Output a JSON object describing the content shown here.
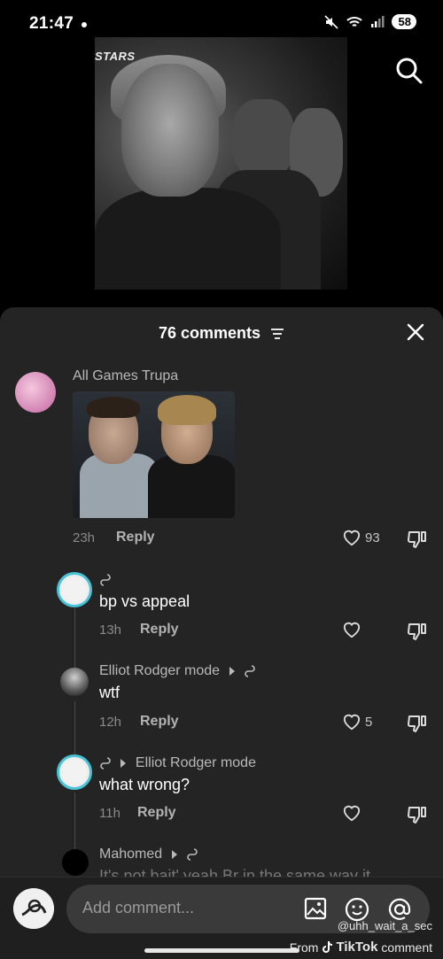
{
  "status_bar": {
    "time": "21:47",
    "battery": "58"
  },
  "video": {
    "brand_text": "STARS"
  },
  "comments_header": {
    "count_label": "76 comments"
  },
  "comments": [
    {
      "username": "All Games Trupa",
      "time": "23h",
      "reply_label": "Reply",
      "likes": "93"
    },
    {
      "username": "",
      "text": "bp vs appeal",
      "time": "13h",
      "reply_label": "Reply",
      "likes": ""
    },
    {
      "username": "Elliot Rodger mode",
      "text": "wtf",
      "time": "12h",
      "reply_label": "Reply",
      "likes": "5"
    },
    {
      "reply_to": "Elliot Rodger mode",
      "text": "what wrong?",
      "time": "11h",
      "reply_label": "Reply",
      "likes": ""
    },
    {
      "username": "Mahomed",
      "text": "It's not bait' yeah Br in the same way it"
    }
  ],
  "composer": {
    "placeholder": "Add comment..."
  },
  "watermark": {
    "user": "@uhh_wait_a_sec",
    "from": "From",
    "brand": "TikTok",
    "suffix": "comment"
  }
}
